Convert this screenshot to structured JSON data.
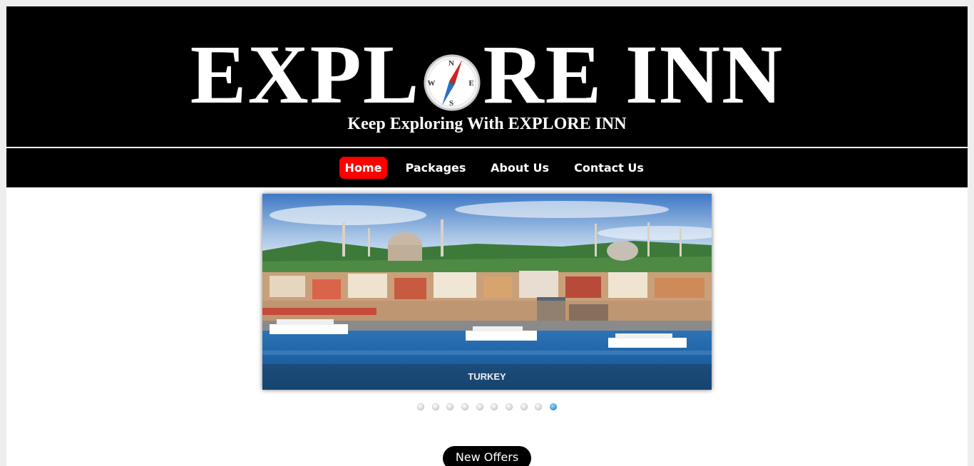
{
  "header": {
    "logo_left": "EXPL",
    "logo_right": "RE INN",
    "tagline": "Keep Exploring With EXPLORE INN",
    "compass_letters": {
      "n": "N",
      "e": "E",
      "s": "S",
      "w": "W"
    }
  },
  "nav": {
    "items": [
      {
        "label": "Home",
        "active": true
      },
      {
        "label": "Packages",
        "active": false
      },
      {
        "label": "About Us",
        "active": false
      },
      {
        "label": "Contact Us",
        "active": false
      }
    ]
  },
  "slider": {
    "caption": "TURKEY",
    "slide_count": 10,
    "active_index": 9
  },
  "offers": {
    "label": "New Offers"
  },
  "colors": {
    "header_bg": "#000000",
    "nav_active": "#ff0000",
    "dot_active": "#2f8fd8"
  }
}
